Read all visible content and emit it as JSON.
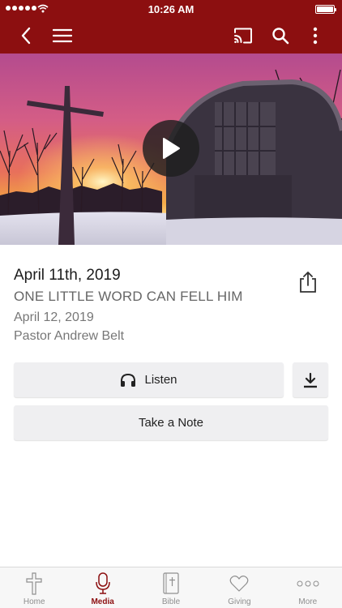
{
  "status_bar": {
    "time": "10:26 AM"
  },
  "hero": {
    "video_label": "Sermon video"
  },
  "sermon": {
    "title": "April 11th, 2019",
    "subtitle": "ONE LITTLE WORD CAN FELL HIM",
    "date": "April 12, 2019",
    "speaker": "Pastor Andrew Belt"
  },
  "actions": {
    "listen_label": "Listen",
    "note_label": "Take a Note"
  },
  "tabs": [
    {
      "label": "Home",
      "icon": "cross-icon",
      "active": false
    },
    {
      "label": "Media",
      "icon": "microphone-icon",
      "active": true
    },
    {
      "label": "Bible",
      "icon": "bible-icon",
      "active": false
    },
    {
      "label": "Giving",
      "icon": "heart-icon",
      "active": false
    },
    {
      "label": "More",
      "icon": "more-icon",
      "active": false
    }
  ],
  "colors": {
    "brand": "#8c0f10",
    "tab_inactive": "#8e8e8e"
  }
}
